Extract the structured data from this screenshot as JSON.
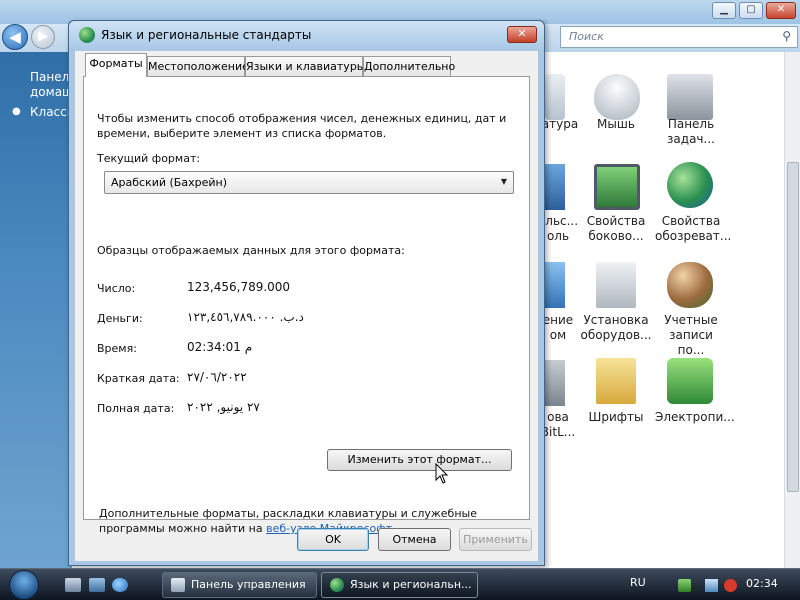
{
  "control_panel": {
    "search_placeholder": "Поиск",
    "sidebar": {
      "item1_line1": "Панель",
      "item1_line2": "домаш",
      "item2": "Класси"
    },
    "items": [
      {
        "line1": "атура",
        "line2": "",
        "icon": "keyboard-icon"
      },
      {
        "line1": "Мышь",
        "line2": "",
        "icon": "mouse-icon"
      },
      {
        "line1": "Панель",
        "line2": "задач...",
        "icon": "taskbar-icon"
      },
      {
        "line1": "ольс...",
        "line2": "оль",
        "icon": "user-accounts-icon"
      },
      {
        "line1": "Свойства",
        "line2": "боково...",
        "icon": "sidebar-properties-icon"
      },
      {
        "line1": "Свойства",
        "line2": "обозреват...",
        "icon": "internet-options-icon"
      },
      {
        "line1": "ение",
        "line2": "ом",
        "icon": "display-icon"
      },
      {
        "line1": "Установка",
        "line2": "оборудов...",
        "icon": "add-hardware-icon"
      },
      {
        "line1": "Учетные",
        "line2": "записи по...",
        "icon": "user-accounts-icon"
      },
      {
        "line1": "ова",
        "line2": "BitL...",
        "icon": "bitlocker-icon"
      },
      {
        "line1": "Шрифты",
        "line2": "",
        "icon": "fonts-icon"
      },
      {
        "line1": "Электропи...",
        "line2": "",
        "icon": "power-options-icon"
      }
    ]
  },
  "dialog": {
    "title": "Язык и региональные стандарты",
    "tabs": [
      "Форматы",
      "Местоположение",
      "Языки и клавиатуры",
      "Дополнительно"
    ],
    "intro_line1": "Чтобы изменить способ отображения чисел, денежных единиц, дат и",
    "intro_line2": "времени, выберите элемент из списка форматов.",
    "current_format_label": "Текущий формат:",
    "current_format_value": "Арабский (Бахрейн)",
    "samples_heading": "Образцы отображаемых данных для этого формата:",
    "samples": [
      {
        "label": "Число:",
        "value": "123,456,789.000"
      },
      {
        "label": "Деньги:",
        "value": "د.ب.‏ ١٢٣,٤٥٦,٧٨٩.٠٠٠"
      },
      {
        "label": "Время:",
        "value": "02:34:01 م"
      },
      {
        "label": "Краткая дата:",
        "value": "٢٧/٠٦/٢٠٢٢"
      },
      {
        "label": "Полная дата:",
        "value": "٢٧ يونيو, ٢٠٢٢"
      }
    ],
    "change_format_button": "Изменить этот формат...",
    "footer_line1": "Дополнительные форматы, раскладки клавиатуры и служебные",
    "footer_line2_prefix": "программы можно найти на ",
    "footer_link": "веб-узле Майкрософт",
    "footer_line2_suffix": ".",
    "ok": "OK",
    "cancel": "Отмена",
    "apply": "Применить"
  },
  "taskbar": {
    "tasks": [
      {
        "label": "Панель управления",
        "active": false
      },
      {
        "label": "Язык и региональн...",
        "active": true
      }
    ],
    "language": "RU",
    "clock": "02:34"
  }
}
